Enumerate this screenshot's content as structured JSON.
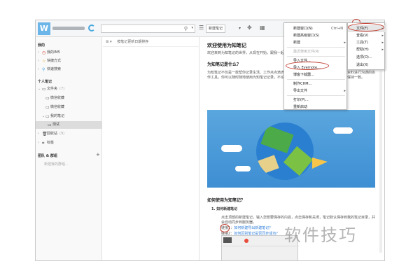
{
  "topbar": {
    "avatar_letter": "W",
    "search_icon": "search-icon",
    "new_note_label": "新建笔记",
    "minimize": "–",
    "restore": "□",
    "close": "×"
  },
  "sidebar": {
    "recent_header": "我的",
    "items_top": [
      {
        "label": "我的IM5",
        "icon": "clock-icon"
      },
      {
        "label": "快捷方式",
        "icon": "star-icon"
      },
      {
        "label": "快速搜索",
        "icon": "search-icon"
      }
    ],
    "notes_header": "个人笔记",
    "folder_label": "文件夹",
    "folder_count": "(7)",
    "sub1": "微信收藏",
    "sub2": "微信收藏",
    "my_notes": "我的笔记",
    "test": "测试",
    "trash": "回收站",
    "trash_count": "(9)",
    "tags": "标签",
    "team_header": "团队 & 群组",
    "team_add": "+",
    "team_empty": "新建我的群组..."
  },
  "list": {
    "header": "按笔记更新日期排序"
  },
  "content": {
    "title": "欢迎使用为知笔记",
    "welcome": "欢迎来到为知笔记的世界，从现在开始，跟我一起...",
    "q1": "为知笔记是什么？",
    "p1": "为知笔记不仅是一款帮你记录生活、工作点点滴滴的云服务笔记，也是一款共享资料、基于资料进行沟通的协作工具。你可以随时随地使用为知笔记记录，不论是在电脑、手机、平板、网页都可以同步保持一致。",
    "q2": "如何使用为知笔记？",
    "step1": "1.  如何新建笔记",
    "step1_desc": "点击顶部的新建笔记，输入您想要保存的内容，点击保存和关闭，笔记默认保存到我的笔记目录，并会自动同步到服务器。",
    "link1_label": "链接1：",
    "link1": "如何新建导出新建笔记？",
    "link2_label": "链接2：",
    "link2": "如何区别笔记是否同步成功？"
  },
  "menu": {
    "items": [
      {
        "label": "新建窗口(N)",
        "shortcut": "Ctrl+N"
      },
      {
        "label": "新建高级窗口(S)",
        "shortcut": ""
      },
      {
        "label": "新建",
        "shortcut": "",
        "submenu": true
      },
      {
        "label": "最近使用文件(R)",
        "shortcut": "",
        "disabled": true
      },
      {
        "label": "导入文件...",
        "shortcut": ""
      },
      {
        "label": "导入 Evernote...",
        "shortcut": ""
      },
      {
        "label": "博客下载器...",
        "shortcut": ""
      },
      {
        "label": "制作CHM...",
        "shortcut": ""
      },
      {
        "label": "导出文件",
        "shortcut": "",
        "submenu": true
      },
      {
        "label": "打印(P)...",
        "shortcut": ""
      },
      {
        "label": "重新启动",
        "shortcut": ""
      }
    ]
  },
  "menu2": {
    "items": [
      {
        "label": "文件(F)"
      },
      {
        "label": "查看(V)"
      },
      {
        "label": "工具(T)"
      },
      {
        "label": "帮助(H)"
      },
      {
        "label": "选项(O)..."
      },
      {
        "label": "退出(X)"
      }
    ]
  },
  "watermark": "软件技巧",
  "colors": {
    "accent": "#48a8e0",
    "highlight_circle": "#c0392b"
  }
}
